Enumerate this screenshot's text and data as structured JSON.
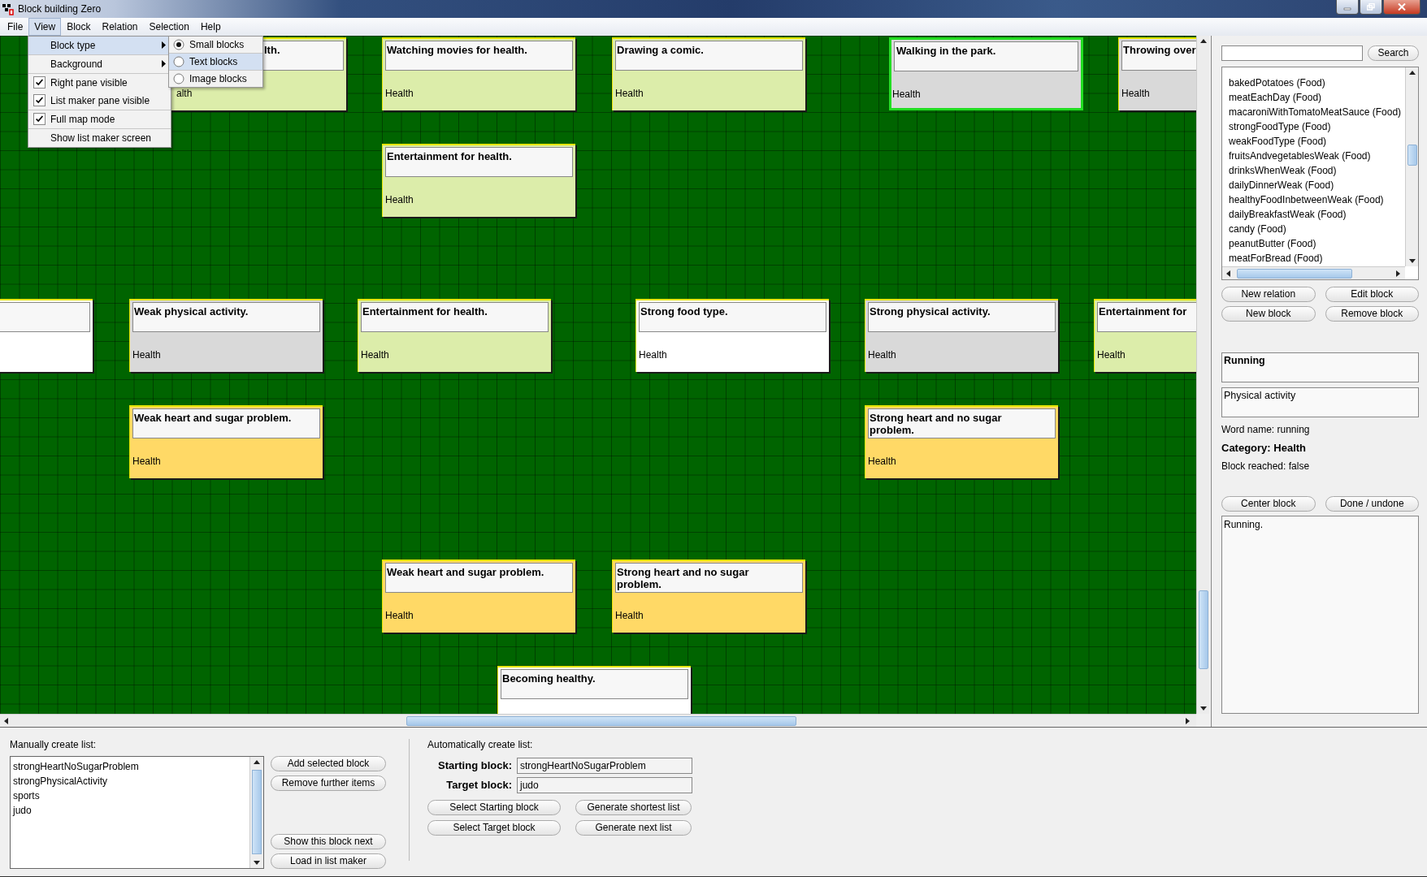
{
  "window": {
    "title": "Block building Zero"
  },
  "menu_bar": [
    {
      "label": "File",
      "selected": false
    },
    {
      "label": "View",
      "selected": true
    },
    {
      "label": "Block",
      "selected": false
    },
    {
      "label": "Relation",
      "selected": false
    },
    {
      "label": "Selection",
      "selected": false
    },
    {
      "label": "Help",
      "selected": false
    }
  ],
  "view_menu": {
    "groups": [
      [
        {
          "kind": "submenu",
          "label": "Block type",
          "highlighted": true
        }
      ],
      [
        {
          "kind": "submenu",
          "label": "Background",
          "highlighted": false
        }
      ],
      [
        {
          "kind": "check",
          "label": "Right pane visible",
          "checked": true,
          "highlighted": false
        },
        {
          "kind": "check",
          "label": "List maker pane visible",
          "checked": true,
          "highlighted": false
        }
      ],
      [
        {
          "kind": "check",
          "label": "Full map mode",
          "checked": true,
          "highlighted": false
        }
      ],
      [
        {
          "kind": "plain",
          "label": "Show list maker screen",
          "highlighted": false
        }
      ]
    ]
  },
  "block_type_submenu": [
    {
      "label": "Small blocks",
      "selected": true,
      "highlighted": false
    },
    {
      "label": "Text blocks",
      "selected": false,
      "highlighted": true
    },
    {
      "label": "Image blocks",
      "selected": false,
      "highlighted": false
    }
  ],
  "blocks": [
    {
      "title": "lth.",
      "category": "alth",
      "color": "#dcedaa",
      "selected": false
    },
    {
      "title": "Watching movies for health.",
      "category": "Health",
      "color": "#dcedaa",
      "selected": false
    },
    {
      "title": "Drawing a comic.",
      "category": "Health",
      "color": "#dcedaa",
      "selected": false
    },
    {
      "title": "Walking in the park.",
      "category": "Health",
      "color": "#d9d9d9",
      "selected": true
    },
    {
      "title": "Throwing over",
      "category": "Health",
      "color": "#d9d9d9",
      "selected": false
    },
    {
      "title": "Entertainment for health.",
      "category": "Health",
      "color": "#dcedaa",
      "selected": false
    },
    {
      "color": "#ffffff",
      "selected": false
    },
    {
      "title": "Weak physical activity.",
      "category": "Health",
      "color": "#d9d9d9",
      "selected": false
    },
    {
      "title": "Entertainment for health.",
      "category": "Health",
      "color": "#dcedaa",
      "selected": false
    },
    {
      "title": "Strong food type.",
      "category": "Health",
      "color": "#ffffff",
      "selected": false
    },
    {
      "title": "Strong physical activity.",
      "category": "Health",
      "color": "#d9d9d9",
      "selected": false
    },
    {
      "title": "Entertainment for",
      "category": "Health",
      "color": "#dcedaa",
      "selected": false
    },
    {
      "title": "Weak heart and sugar problem.",
      "category": "Health",
      "color": "#ffd966",
      "selected": false
    },
    {
      "title": "Strong heart and no sugar problem.",
      "category": "Health",
      "color": "#ffd966",
      "selected": false
    },
    {
      "title": "Weak heart and sugar problem.",
      "category": "Health",
      "color": "#ffd966",
      "selected": false
    },
    {
      "title": "Strong heart and no sugar problem.",
      "category": "Health",
      "color": "#ffd966",
      "selected": false
    },
    {
      "title": "Becoming healthy.",
      "color": "#ffffff",
      "selected": false
    }
  ],
  "right_pane": {
    "search_button": "Search",
    "word_list": [
      "bakedPotatoes (Food)",
      "meatEachDay (Food)",
      "macaroniWithTomatoMeatSauce (Food)",
      "strongFoodType (Food)",
      "weakFoodType (Food)",
      "fruitsAndvegetablesWeak (Food)",
      "drinksWhenWeak (Food)",
      "dailyDinnerWeak (Food)",
      "healthyFoodInbetweenWeak (Food)",
      "dailyBreakfastWeak (Food)",
      "candy (Food)",
      "peanutButter (Food)",
      "meatForBread (Food)"
    ],
    "buttons": [
      "New relation",
      "Edit block",
      "New block",
      "Remove block"
    ],
    "block_title": "Running",
    "block_subtitle": "Physical activity",
    "word_name": "Word name: running",
    "category": "Category: Health",
    "block_reached": "Block reached: false",
    "buttons_2": [
      "Center block",
      "Done / undone"
    ],
    "description": "Running."
  },
  "list_maker": {
    "manual_label": "Manually create list:",
    "manual_list": [
      "strongHeartNoSugarProblem",
      "strongPhysicalActivity",
      "sports",
      "judo"
    ],
    "manual_buttons_top": [
      "Add selected block",
      "Remove further items"
    ],
    "manual_buttons_bottom": [
      "Show this block next",
      "Load in list maker"
    ],
    "auto_label": "Automatically create list:",
    "starting_label": "Starting block:",
    "starting_value": "strongHeartNoSugarProblem",
    "target_label": "Target block:",
    "target_value": "judo",
    "auto_buttons": [
      "Select Starting block",
      "Generate shortest list",
      "Select Target block",
      "Generate next list"
    ]
  }
}
